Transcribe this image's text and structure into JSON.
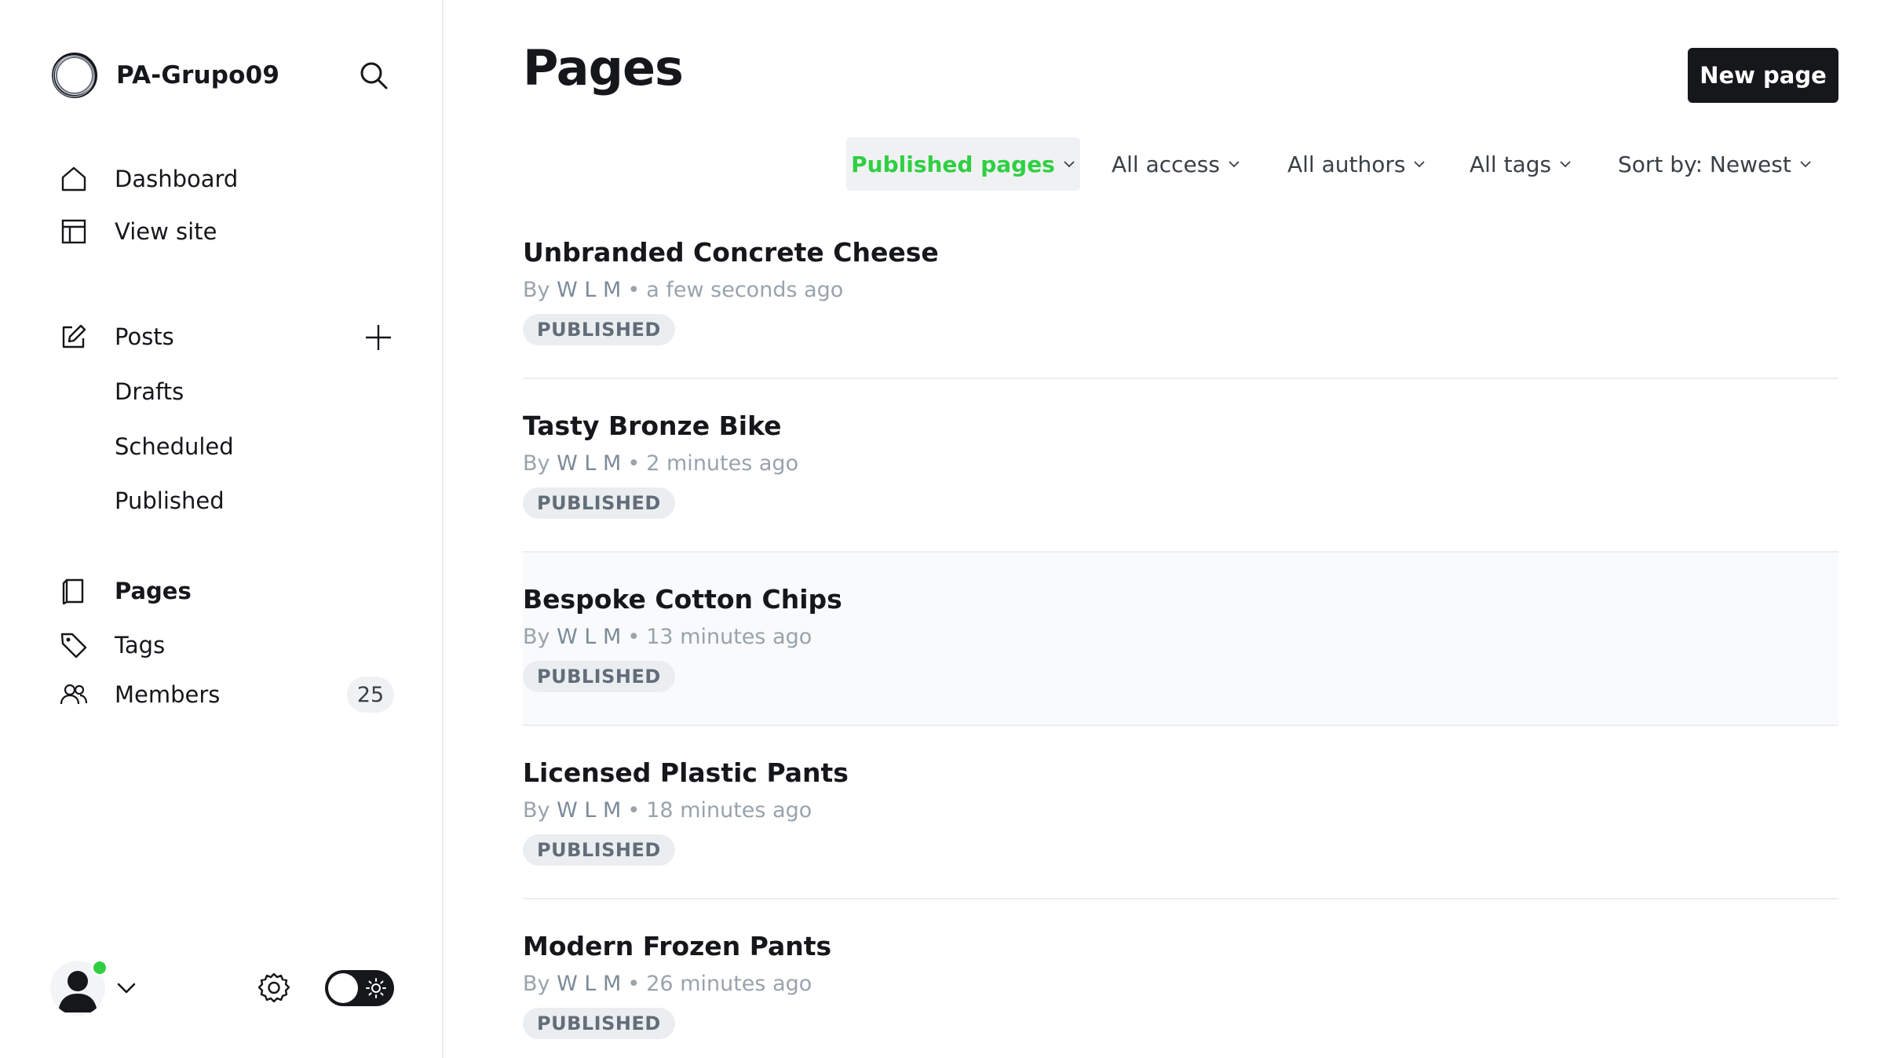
{
  "sidebar": {
    "site_title": "PA-Grupo09",
    "nav_primary": [
      {
        "label": "Dashboard",
        "icon": "home-icon"
      },
      {
        "label": "View site",
        "icon": "layout-icon"
      }
    ],
    "posts": {
      "label": "Posts",
      "icon": "edit-icon",
      "sub_items": [
        "Drafts",
        "Scheduled",
        "Published"
      ]
    },
    "nav_secondary": [
      {
        "label": "Pages",
        "icon": "page-icon",
        "active": true
      },
      {
        "label": "Tags",
        "icon": "tag-icon"
      },
      {
        "label": "Members",
        "icon": "members-icon",
        "count": "25"
      }
    ]
  },
  "header": {
    "title": "Pages",
    "new_page_label": "New page"
  },
  "filters": {
    "type": "Published pages",
    "access": "All access",
    "authors": "All authors",
    "tags": "All tags",
    "sort": "Sort by: Newest"
  },
  "pages": [
    {
      "title": "Unbranded Concrete Cheese",
      "by": "By",
      "author": "W L M",
      "time": "a few seconds ago",
      "status": "PUBLISHED"
    },
    {
      "title": "Tasty Bronze Bike",
      "by": "By",
      "author": "W L M",
      "time": "2 minutes ago",
      "status": "PUBLISHED"
    },
    {
      "title": "Bespoke Cotton Chips",
      "by": "By",
      "author": "W L M",
      "time": "13 minutes ago",
      "status": "PUBLISHED"
    },
    {
      "title": "Licensed Plastic Pants",
      "by": "By",
      "author": "W L M",
      "time": "18 minutes ago",
      "status": "PUBLISHED"
    },
    {
      "title": "Modern Frozen Pants",
      "by": "By",
      "author": "W L M",
      "time": "26 minutes ago",
      "status": "PUBLISHED"
    }
  ],
  "colors": {
    "accent_green": "#30cf43",
    "primary_dark": "#15171a",
    "muted_text": "#99a3ad",
    "divider": "#ebeef0"
  }
}
